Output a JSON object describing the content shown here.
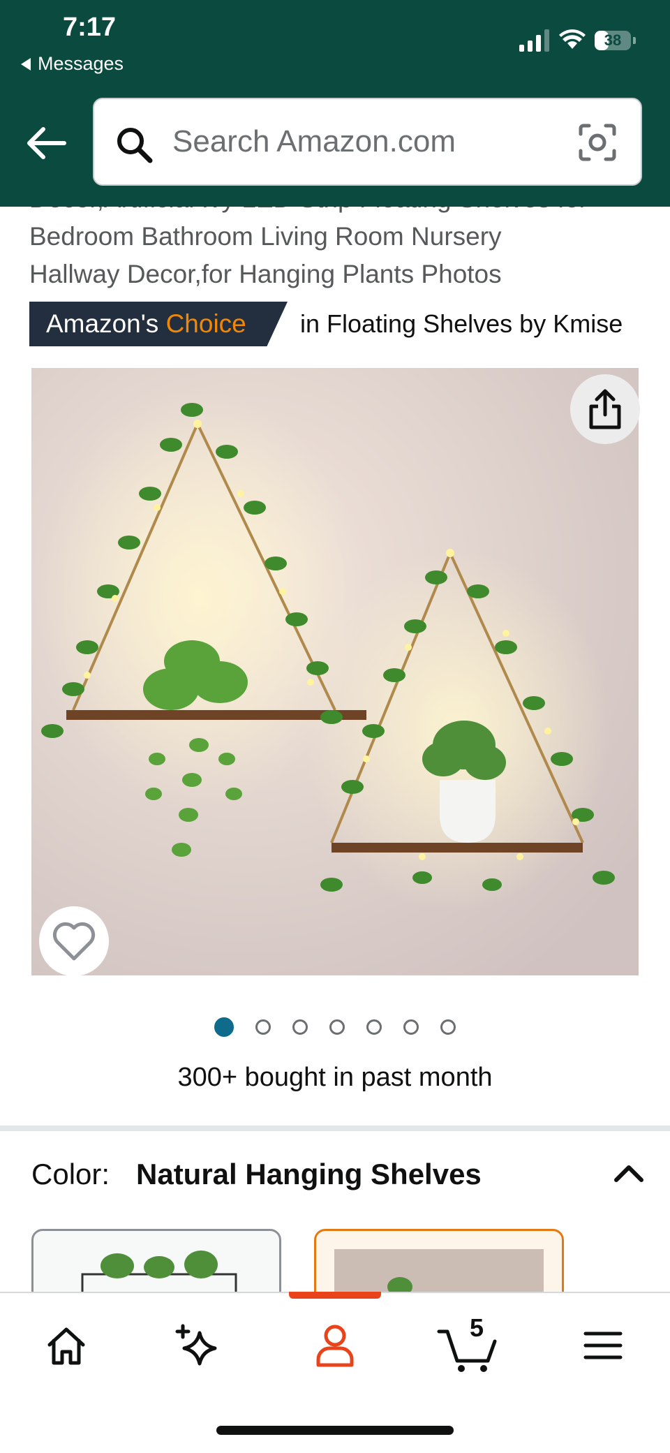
{
  "status_bar": {
    "time": "7:17",
    "back_app": "Messages",
    "battery": "38",
    "battery_level": 0.38,
    "icons": [
      "cellular-signal-icon",
      "wifi-icon",
      "battery-icon"
    ]
  },
  "header": {
    "back_icon": "arrow-left-icon",
    "search_placeholder": "Search Amazon.com",
    "search_icon": "search-icon",
    "camera_icon": "camera-scan-icon"
  },
  "product": {
    "title_lines": [
      "Decor,Artificial Ivy LED Strip Floating Shelves for",
      "Bedroom Bathroom Living Room Nursery",
      "Hallway Decor,for Hanging Plants Photos"
    ],
    "badge_prefix": "Amazon's ",
    "badge_choice": "Choice",
    "badge_category": "in Floating Shelves by Kmise",
    "image_count": 7,
    "active_image": 1,
    "bought_text": "300+ bought in past month"
  },
  "color": {
    "label": "Color:",
    "value": "Natural Hanging Shelves"
  },
  "bottom_nav": {
    "items": [
      "home-icon",
      "ai-sparkle-icon",
      "account-icon",
      "cart-icon",
      "menu-icon"
    ],
    "active": "account-icon",
    "cart_count": "5"
  },
  "colors": {
    "header_bg": "#0a4a3f",
    "accent": "#f08804",
    "active_nav": "#e8431b",
    "dot_active": "#0f6b8c"
  }
}
